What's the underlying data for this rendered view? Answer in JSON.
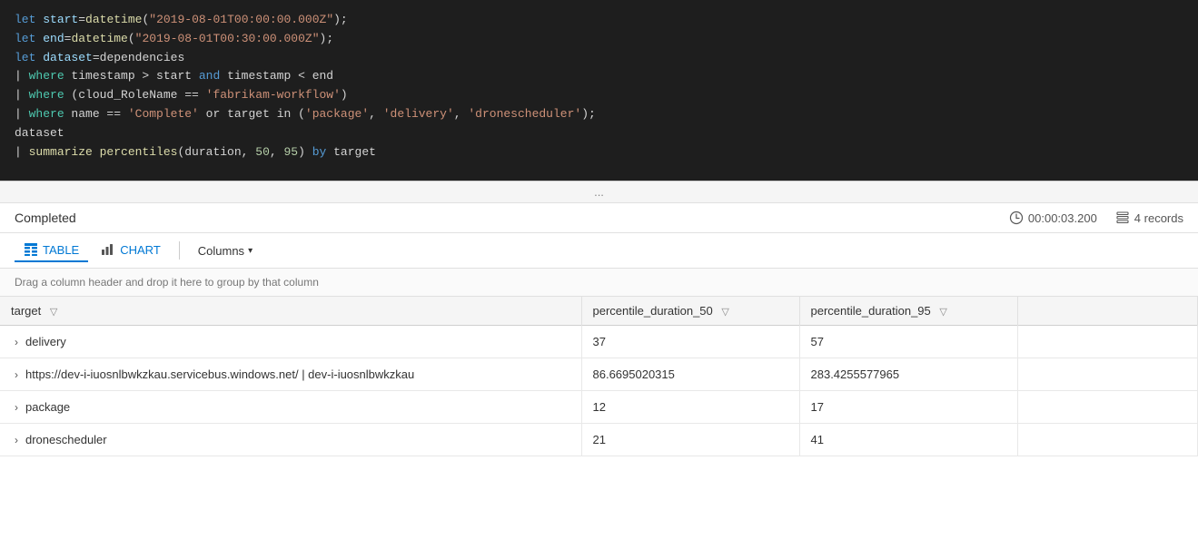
{
  "code": {
    "lines": [
      {
        "id": "line1",
        "tokens": [
          {
            "t": "kw",
            "v": "let "
          },
          {
            "t": "var",
            "v": "start"
          },
          {
            "t": "op",
            "v": "="
          },
          {
            "t": "fn",
            "v": "datetime"
          },
          {
            "t": "op",
            "v": "("
          },
          {
            "t": "str",
            "v": "\"2019-08-01T00:00:00.000Z\""
          },
          {
            "t": "op",
            "v": ");"
          }
        ]
      },
      {
        "id": "line2",
        "tokens": [
          {
            "t": "kw",
            "v": "let "
          },
          {
            "t": "var",
            "v": "end"
          },
          {
            "t": "op",
            "v": "="
          },
          {
            "t": "fn",
            "v": "datetime"
          },
          {
            "t": "op",
            "v": "("
          },
          {
            "t": "str",
            "v": "\"2019-08-01T00:30:00.000Z\""
          },
          {
            "t": "op",
            "v": ");"
          }
        ]
      },
      {
        "id": "line3",
        "tokens": [
          {
            "t": "kw",
            "v": "let "
          },
          {
            "t": "var",
            "v": "dataset"
          },
          {
            "t": "op",
            "v": "="
          },
          {
            "t": "plain",
            "v": "dependencies"
          }
        ]
      },
      {
        "id": "line4",
        "tokens": [
          {
            "t": "pipe",
            "v": "| "
          },
          {
            "t": "kw-where",
            "v": "where "
          },
          {
            "t": "plain",
            "v": "timestamp > start "
          },
          {
            "t": "kw-and",
            "v": "and "
          },
          {
            "t": "plain",
            "v": "timestamp < end"
          }
        ]
      },
      {
        "id": "line5",
        "tokens": [
          {
            "t": "pipe",
            "v": "| "
          },
          {
            "t": "kw-where",
            "v": "where "
          },
          {
            "t": "plain",
            "v": "(cloud_RoleName == "
          },
          {
            "t": "str",
            "v": "'fabrikam-workflow'"
          },
          {
            "t": "plain",
            "v": ")"
          }
        ]
      },
      {
        "id": "line6",
        "tokens": [
          {
            "t": "pipe",
            "v": "| "
          },
          {
            "t": "kw-where",
            "v": "where "
          },
          {
            "t": "plain",
            "v": "name == "
          },
          {
            "t": "str",
            "v": "'Complete'"
          },
          {
            "t": "plain",
            "v": " "
          },
          {
            "t": "kw-or",
            "v": "or"
          },
          {
            "t": "plain",
            "v": " target "
          },
          {
            "t": "plain",
            "v": "in ("
          },
          {
            "t": "str",
            "v": "'package'"
          },
          {
            "t": "plain",
            "v": ", "
          },
          {
            "t": "str",
            "v": "'delivery'"
          },
          {
            "t": "plain",
            "v": ", "
          },
          {
            "t": "str",
            "v": "'dronescheduler'"
          },
          {
            "t": "plain",
            "v": ");"
          }
        ]
      },
      {
        "id": "line7",
        "tokens": [
          {
            "t": "plain",
            "v": "dataset"
          }
        ]
      },
      {
        "id": "line8",
        "tokens": [
          {
            "t": "pipe",
            "v": "| "
          },
          {
            "t": "fn",
            "v": "summarize "
          },
          {
            "t": "fn2",
            "v": "percentiles"
          },
          {
            "t": "plain",
            "v": "(duration, "
          },
          {
            "t": "num",
            "v": "50"
          },
          {
            "t": "plain",
            "v": ", "
          },
          {
            "t": "num",
            "v": "95"
          },
          {
            "t": "plain",
            "v": ") "
          },
          {
            "t": "kw-and",
            "v": "by "
          },
          {
            "t": "plain",
            "v": "target"
          }
        ]
      }
    ],
    "ellipsis": "..."
  },
  "results": {
    "status": "Completed",
    "time_label": "00:00:03.200",
    "records_label": "4 records",
    "tabs": [
      {
        "id": "table",
        "label": "TABLE",
        "active": true
      },
      {
        "id": "chart",
        "label": "CHART",
        "active": false
      }
    ],
    "columns_label": "Columns",
    "drag_hint": "Drag a column header and drop it here to group by that column",
    "table": {
      "columns": [
        {
          "id": "target",
          "label": "target"
        },
        {
          "id": "percentile_duration_50",
          "label": "percentile_duration_50"
        },
        {
          "id": "percentile_duration_95",
          "label": "percentile_duration_95"
        },
        {
          "id": "extra",
          "label": ""
        }
      ],
      "rows": [
        {
          "target": "delivery",
          "p50": "37",
          "p95": "57"
        },
        {
          "target": "https://dev-i-iuosnlbwkzkau.servicebus.windows.net/ | dev-i-iuosnlbwkzkau",
          "p50": "86.6695020315",
          "p95": "283.4255577965"
        },
        {
          "target": "package",
          "p50": "12",
          "p95": "17"
        },
        {
          "target": "dronescheduler",
          "p50": "21",
          "p95": "41"
        }
      ]
    }
  }
}
